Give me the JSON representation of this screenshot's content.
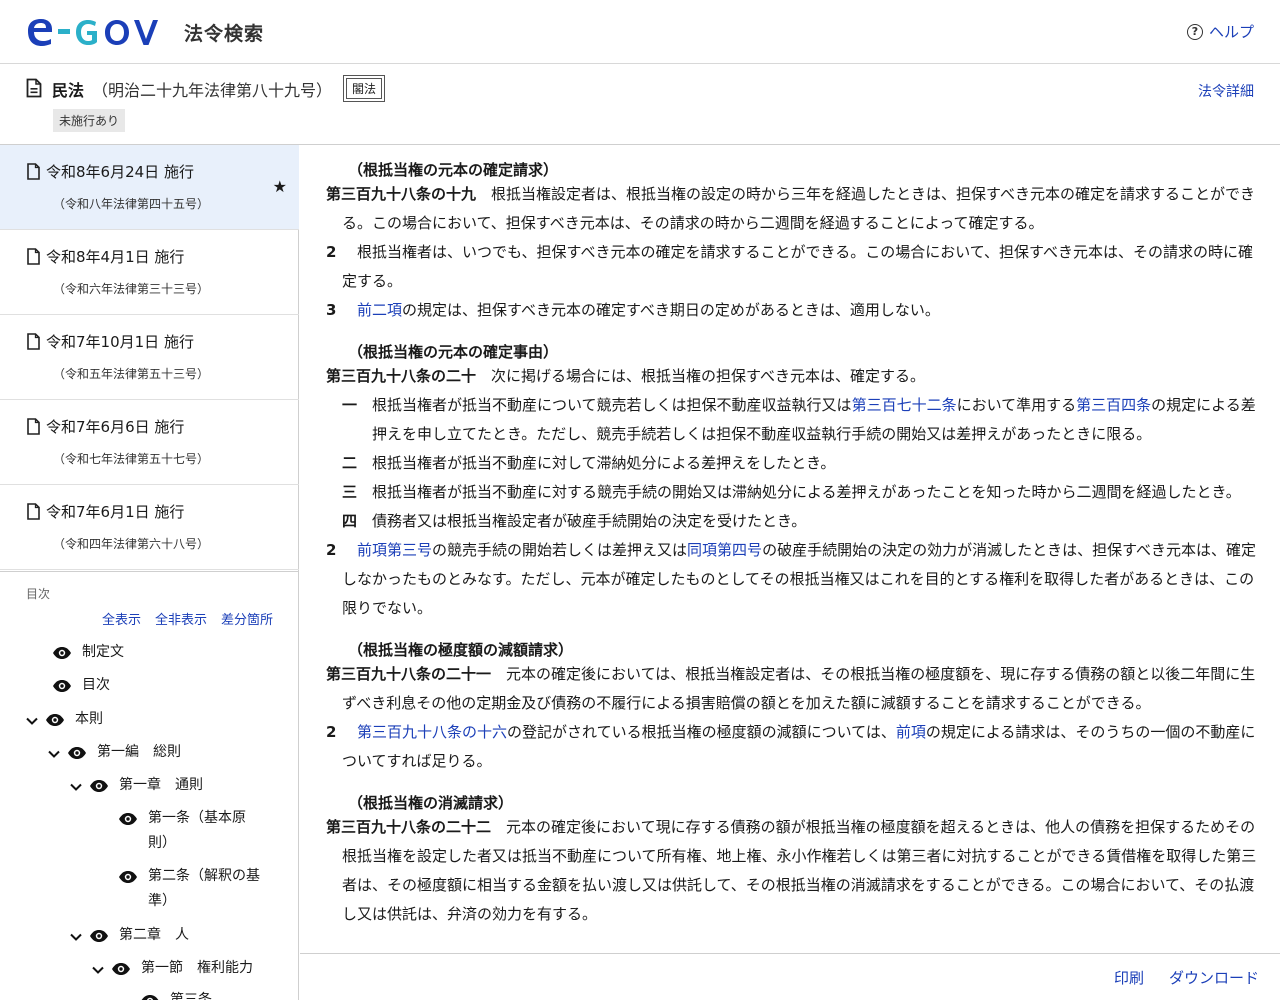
{
  "header": {
    "site_title": "法令検索",
    "help_label": "ヘルプ",
    "brand_colors": {
      "blue": "#1b3fb8",
      "teal": "#2bb0c9"
    }
  },
  "law": {
    "name": "民法",
    "number": "（明治二十九年法律第八十九号）",
    "category": "閣法",
    "status": "未施行あり",
    "detail_label": "法令詳細"
  },
  "history": [
    {
      "date": "令和8年6月24日 施行",
      "law": "（令和八年法律第四十五号）",
      "active": true
    },
    {
      "date": "令和8年4月1日 施行",
      "law": "（令和六年法律第三十三号）"
    },
    {
      "date": "令和7年10月1日 施行",
      "law": "（令和五年法律第五十三号）"
    },
    {
      "date": "令和7年6月6日 施行",
      "law": "（令和七年法律第五十七号）"
    },
    {
      "date": "令和7年6月1日 施行",
      "law": "（令和四年法律第六十八号）"
    }
  ],
  "toc": {
    "label": "目次",
    "controls": [
      "全表示",
      "全非表示",
      "差分箇所"
    ],
    "items": [
      "制定文",
      "目次",
      "本則",
      "第一編　総則",
      "第一章　通則",
      "第一条（基本原",
      "則）",
      "第二条（解釈の基",
      "準）",
      "第二章　人",
      "第一節　権利能力",
      "第三条"
    ]
  },
  "articles": {
    "a19": {
      "caption": "（根抵当権の元本の確定請求）",
      "num": "第三百九十八条の十九",
      "text": "　根抵当権設定者は、根抵当権の設定の時から三年を経過したときは、担保すべき元本の確定を請求することができる。この場合において、担保すべき元本は、その請求の時から二週間を経過することによって確定する。",
      "p2_num": "2",
      "p2": "　根抵当権者は、いつでも、担保すべき元本の確定を請求することができる。この場合において、担保すべき元本は、その請求の時に確定する。",
      "p3_num": "3",
      "p3_link": "前二項",
      "p3_text": "の規定は、担保すべき元本の確定すべき期日の定めがあるときは、適用しない。"
    },
    "a20": {
      "caption": "（根抵当権の元本の確定事由）",
      "num": "第三百九十八条の二十",
      "text": "　次に掲げる場合には、根抵当権の担保すべき元本は、確定する。",
      "i1_num": "一",
      "i1_a": "根抵当権者が抵当不動産について競売若しくは担保不動産収益執行又は",
      "i1_link1": "第三百七十二条",
      "i1_b": "において準用する",
      "i1_link2": "第三百四条",
      "i1_c": "の規定による差押えを申し立てたとき。ただし、競売手続若しくは担保不動産収益執行手続の開始又は差押えがあったときに限る。",
      "i2_num": "二",
      "i2": "根抵当権者が抵当不動産に対して滞納処分による差押えをしたとき。",
      "i3_num": "三",
      "i3": "根抵当権者が抵当不動産に対する競売手続の開始又は滞納処分による差押えがあったことを知った時から二週間を経過したとき。",
      "i4_num": "四",
      "i4": "債務者又は根抵当権設定者が破産手続開始の決定を受けたとき。",
      "p2_num": "2",
      "p2_link1": "前項第三号",
      "p2_a": "の競売手続の開始若しくは差押え又は",
      "p2_link2": "同項第四号",
      "p2_b": "の破産手続開始の決定の効力が消滅したときは、担保すべき元本は、確定しなかったものとみなす。ただし、元本が確定したものとしてその根抵当権又はこれを目的とする権利を取得した者があるときは、この限りでない。"
    },
    "a21": {
      "caption": "（根抵当権の極度額の減額請求）",
      "num": "第三百九十八条の二十一",
      "text": "　元本の確定後においては、根抵当権設定者は、その根抵当権の極度額を、現に存する債務の額と以後二年間に生ずべき利息その他の定期金及び債務の不履行による損害賠償の額とを加えた額に減額することを請求することができる。",
      "p2_num": "2",
      "p2_link1": "第三百九十八条の十六",
      "p2_a": "の登記がされている根抵当権の極度額の減額については、",
      "p2_link2": "前項",
      "p2_b": "の規定による請求は、そのうちの一個の不動産についてすれば足りる。"
    },
    "a22": {
      "caption": "（根抵当権の消滅請求）",
      "num": "第三百九十八条の二十二",
      "text": "　元本の確定後において現に存する債務の額が根抵当権の極度額を超えるときは、他人の債務を担保するためその根抵当権を設定した者又は抵当不動産について所有権、地上権、永小作権若しくは第三者に対抗することができる賃借権を取得した第三者は、その極度額に相当する金額を払い渡し又は供託して、その根抵当権の消滅請求をすることができる。この場合において、その払渡し又は供託は、弁済の効力を有する。"
    }
  },
  "footer": {
    "print_label": "印刷",
    "download_label": "ダウンロード"
  }
}
